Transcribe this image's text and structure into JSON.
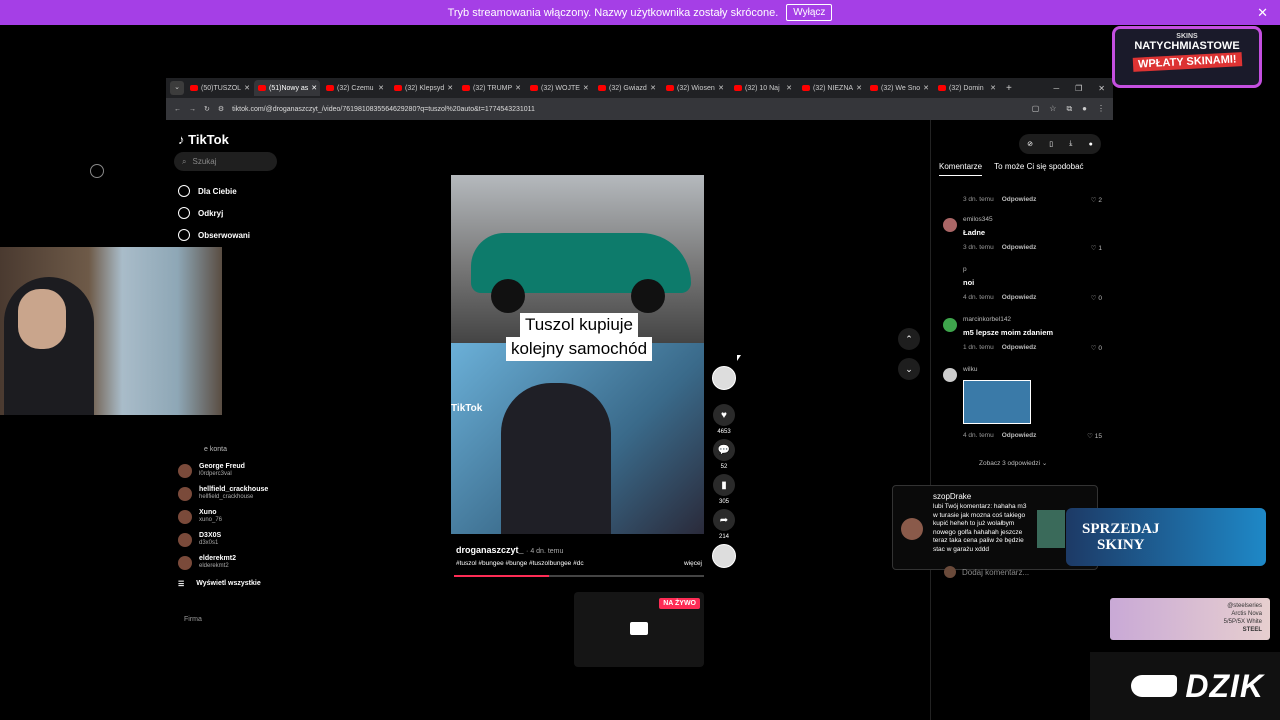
{
  "stream_banner": {
    "text": "Tryb streamowania włączony. Nazwy użytkownika zostały skrócone.",
    "button": "Wyłącz",
    "close": "✕"
  },
  "browser": {
    "tabs": [
      {
        "label": "(50)TUSZOL",
        "active": false
      },
      {
        "label": "(51)Nowy as",
        "active": true
      },
      {
        "label": "(32) Czemu",
        "active": false
      },
      {
        "label": "(32) Klepsyd",
        "active": false
      },
      {
        "label": "(32) TRUMP",
        "active": false
      },
      {
        "label": "(32) WOJTE",
        "active": false
      },
      {
        "label": "(32) Gwiazd",
        "active": false
      },
      {
        "label": "(32) Wiosen",
        "active": false
      },
      {
        "label": "(32) 10 Naj",
        "active": false
      },
      {
        "label": "(32) NIEZNA",
        "active": false
      },
      {
        "label": "(32) We Sno",
        "active": false
      },
      {
        "label": "(32) Domin",
        "active": false
      }
    ],
    "new_tab": "+",
    "url": "tiktok.com/@droganaszczyt_/video/7619810835564629280?q=tuszol%20auto&t=1774543231011"
  },
  "tiktok": {
    "logo": "TikTok",
    "search_placeholder": "Szukaj",
    "nav": [
      {
        "label": "Dla Ciebie",
        "icon": "home-icon"
      },
      {
        "label": "Odkryj",
        "icon": "compass-icon"
      },
      {
        "label": "Obserwowani",
        "icon": "following-icon"
      }
    ],
    "followed_header": "e konta",
    "followed": [
      {
        "name": "George Freud",
        "handle": "l0rdperc3val"
      },
      {
        "name": "hellfield_crackhouse",
        "handle": "hellfield_crackhouse"
      },
      {
        "name": "Xuno",
        "handle": "xuno_76"
      },
      {
        "name": "D3X0S",
        "handle": "d3x0s1"
      },
      {
        "name": "elderekmt2",
        "handle": "elderekmt2"
      }
    ],
    "show_all": "Wyświetl wszystkie",
    "firma": "Firma",
    "video": {
      "caption_line1": "Tuszol kupiuje",
      "caption_line2": "kolejny samochód",
      "watermark": "TikTok",
      "author": "droganaszczyt_",
      "date": "· 4 dn. temu",
      "tags": "#tuszol #bungee #bunge #tuszolbungee #dc",
      "more": "więcej",
      "progress": 0.38
    },
    "actions": {
      "likes": "4653",
      "comments": "52",
      "saves": "305",
      "shares": "214"
    },
    "live": {
      "badge": "NA ŻYWO"
    },
    "comments_panel": {
      "tab_comments": "Komentarze",
      "tab_suggest": "To może Ci się spodobać",
      "items": [
        {
          "user": "",
          "text": "",
          "date": "3 dn. temu",
          "reply": "Odpowiedz",
          "likes": "2"
        },
        {
          "user": "emilos345",
          "text": "Ładne",
          "date": "3 dn. temu",
          "reply": "Odpowiedz",
          "likes": "1"
        },
        {
          "user": "p",
          "text": "noi",
          "date": "4 dn. temu",
          "reply": "Odpowiedz",
          "likes": "0"
        },
        {
          "user": "marcinkorbel142",
          "text": "m5 lepsze moim zdaniem",
          "date": "1 dn. temu",
          "reply": "Odpowiedz",
          "likes": "0"
        },
        {
          "user": "wilku",
          "text": "",
          "date": "4 dn. temu",
          "reply": "Odpowiedz",
          "likes": "15"
        }
      ],
      "more_replies": "Zobacz 3 odpowiedzi ⌄",
      "add_placeholder": "Dodaj komentarz..."
    }
  },
  "overlays": {
    "promo": {
      "brand": "SKINS",
      "line1": "NATYCHMIASTOWE",
      "line2": "WPŁATY SKINAMI!"
    },
    "donation": {
      "user": "szopDrake",
      "text": "lubi Twój komentarz: hahaha m3 w turasie jak mozna coś takiego kupić heheh to już wolałbym nowego golfa hahahah jeszcze teraz taka cena paliw że będzie stac w garażu xddd"
    },
    "sell": {
      "line1": "SPRZEDAJ",
      "line2": "SKINY"
    },
    "steel": {
      "line1": "@steelseries",
      "line2": "Arctis Nova",
      "line3": "5/5P/5X White",
      "brand": "STEEL"
    },
    "dzik": "DZIK"
  }
}
